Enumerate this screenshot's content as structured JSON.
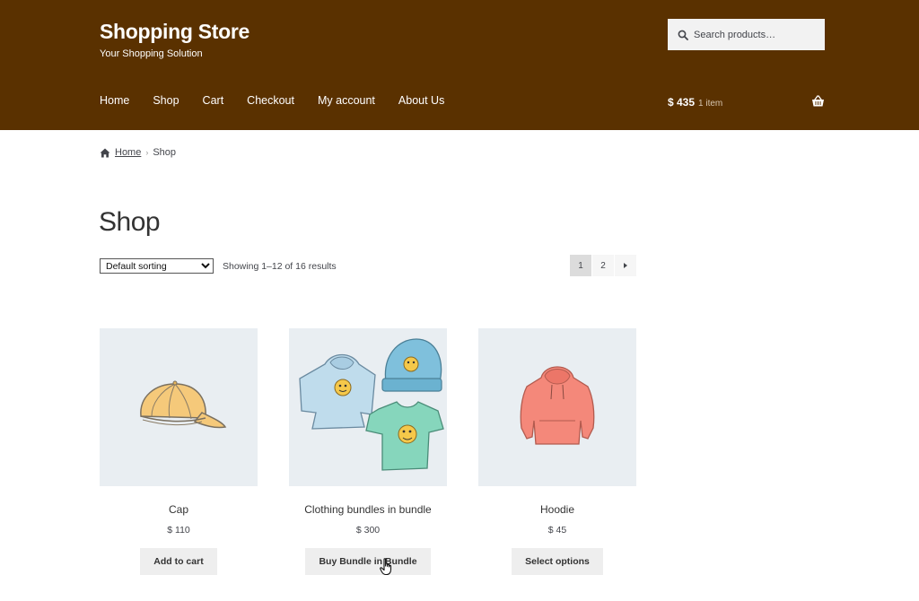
{
  "header": {
    "site_title": "Shopping Store",
    "tagline": "Your Shopping Solution",
    "search_placeholder": "Search products…",
    "nav": [
      {
        "label": "Home"
      },
      {
        "label": "Shop"
      },
      {
        "label": "Cart"
      },
      {
        "label": "Checkout"
      },
      {
        "label": "My account"
      },
      {
        "label": "About Us"
      }
    ],
    "cart_total": "$ 435",
    "cart_count": "1 item",
    "background_color": "#5a3100"
  },
  "breadcrumb": {
    "home": "Home",
    "current": "Shop"
  },
  "page": {
    "title": "Shop",
    "sorting_selected": "Default sorting",
    "result_count": "Showing 1–12 of 16 results",
    "pagination": [
      "1",
      "2"
    ]
  },
  "products": [
    {
      "name": "Cap",
      "price": "$ 110",
      "button": "Add to cart",
      "icon": "cap-image"
    },
    {
      "name": "Clothing bundles in bundle",
      "price": "$ 300",
      "button": "Buy Bundle in Bundle",
      "icon": "clothing-bundle-image"
    },
    {
      "name": "Hoodie",
      "price": "$ 45",
      "button": "Select options",
      "icon": "hoodie-image"
    }
  ]
}
